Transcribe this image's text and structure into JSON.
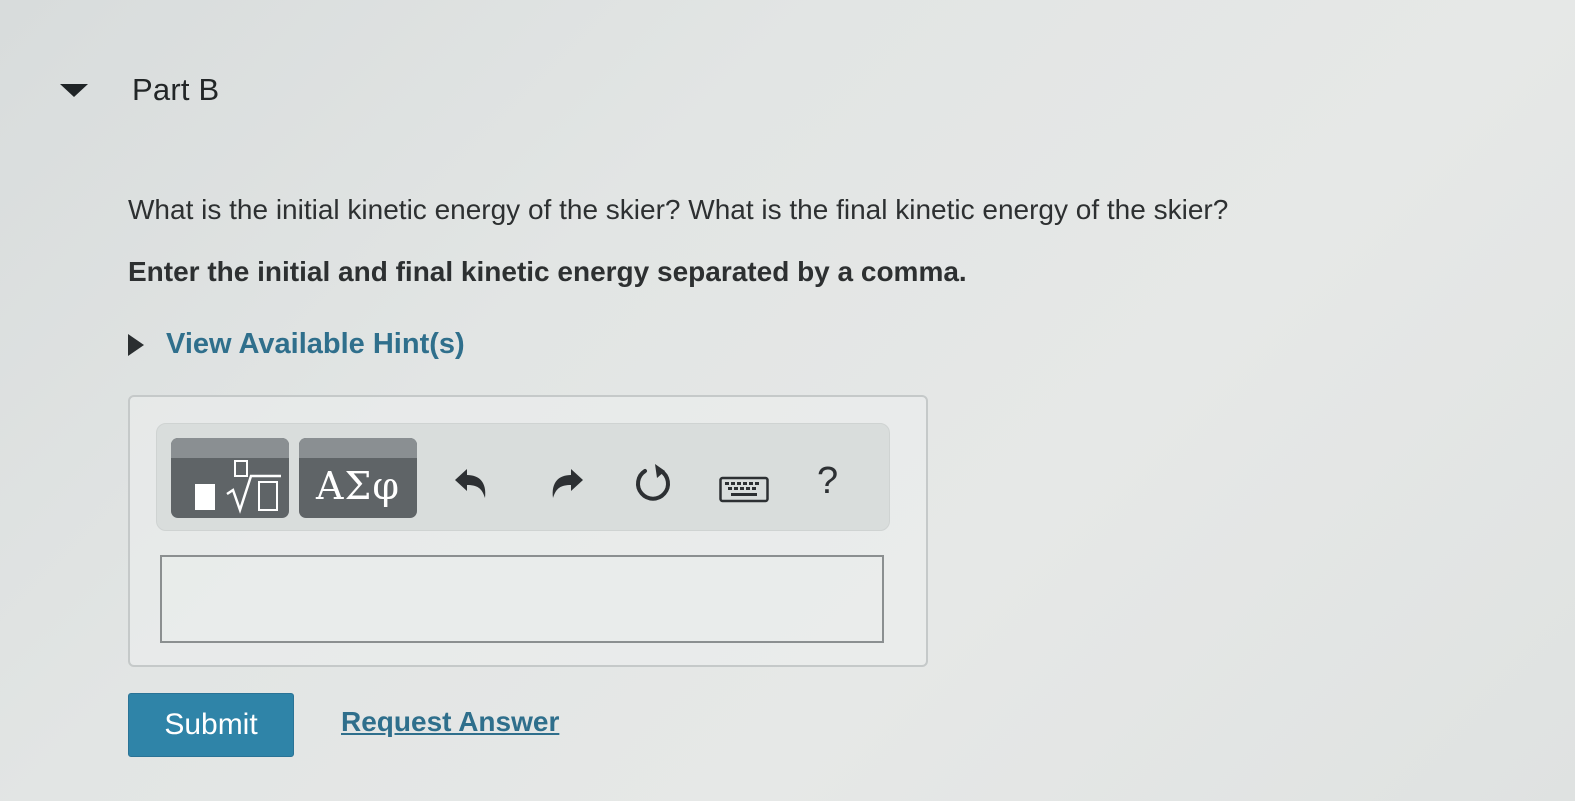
{
  "part": {
    "title": "Part B"
  },
  "question": {
    "text": "What is the initial kinetic energy of the skier? What is the final kinetic energy of the skier?",
    "instruction": "Enter the initial and final kinetic energy separated by a comma."
  },
  "hints": {
    "label": "View Available Hint(s)"
  },
  "toolbar": {
    "templates_icon": "templates-radical-icon",
    "symbols_label": "ΑΣφ",
    "undo_icon": "undo-icon",
    "redo_icon": "redo-icon",
    "reset_icon": "reset-icon",
    "keyboard_icon": "keyboard-icon",
    "help_label": "?"
  },
  "answer": {
    "value": "",
    "placeholder": ""
  },
  "actions": {
    "submit_label": "Submit",
    "request_answer_label": "Request Answer"
  },
  "colors": {
    "accent": "#2f84a8",
    "link": "#2f6f8c",
    "toolbar_button": "#5f6467"
  }
}
